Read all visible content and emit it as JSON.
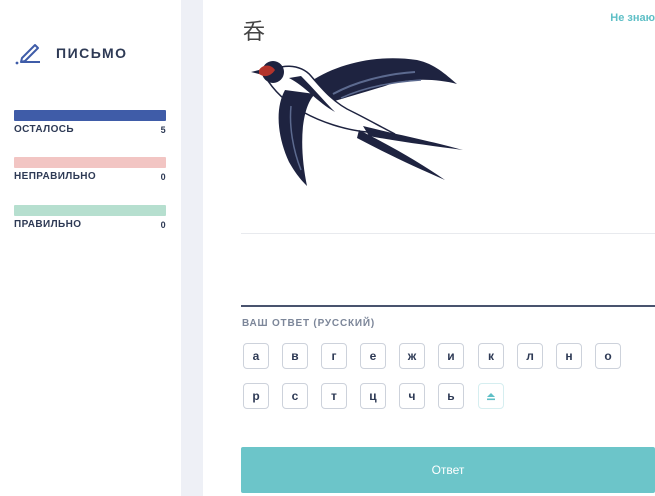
{
  "sidebar": {
    "title": "ПИСЬМО",
    "stats": [
      {
        "label": "ОСТАЛОСЬ",
        "count": "5",
        "color": "#3f5ca8"
      },
      {
        "label": "НЕПРАВИЛЬНО",
        "count": "0",
        "color": "#f2c5c3"
      },
      {
        "label": "ПРАВИЛЬНО",
        "count": "0",
        "color": "#b6dfcf"
      }
    ]
  },
  "main": {
    "prompt_char": "呑",
    "dont_know": "Не знаю",
    "image_icon": "swallow-bird-illustration",
    "answer_label": "ВАШ ОТВЕТ (РУССКИЙ)",
    "keys_row1": [
      "а",
      "в",
      "г",
      "е",
      "ж",
      "и",
      "к",
      "л",
      "н",
      "о"
    ],
    "keys_row2": [
      "р",
      "с",
      "т",
      "ц",
      "ч",
      "ь"
    ],
    "shift_icon": "shift-up-icon",
    "submit_label": "Ответ"
  },
  "colors": {
    "accent": "#6cc5c9",
    "text_dark": "#2e3a55"
  }
}
